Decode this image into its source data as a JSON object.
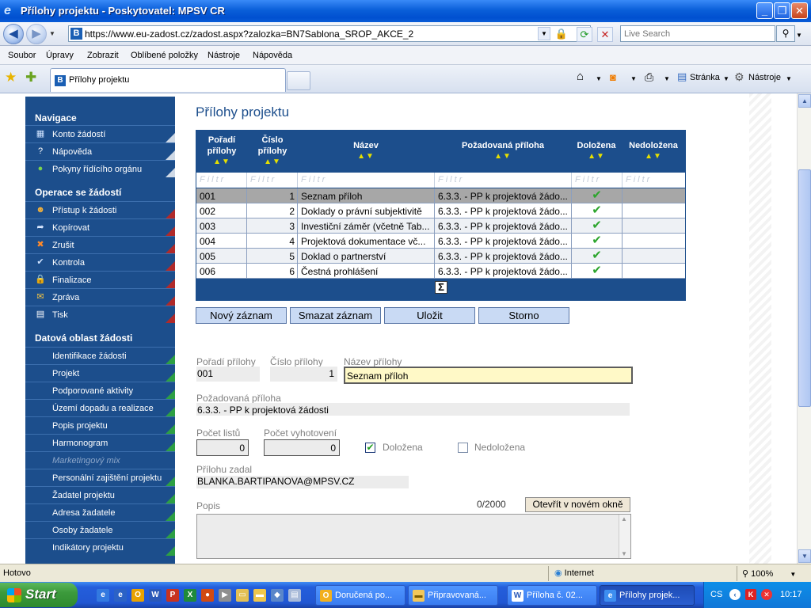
{
  "window": {
    "title": "Přílohy projektu - Poskytovatel: MPSV CR",
    "minimize_glyph": "_",
    "maximize_glyph": "❐",
    "close_glyph": "✕"
  },
  "address": {
    "url": "https://www.eu-zadost.cz/zadost.aspx?zalozka=BN7Sablona_SROP_AKCE_2",
    "search_placeholder": "Live Search",
    "favicon_letter": "B"
  },
  "menu": [
    "Soubor",
    "Úpravy",
    "Zobrazit",
    "Oblíbené položky",
    "Nástroje",
    "Nápověda"
  ],
  "tab": {
    "label": "Přílohy projektu"
  },
  "toolbar": {
    "page_label": "Stránka",
    "tools_label": "Nástroje"
  },
  "sidebar": {
    "sections": {
      "navigace": "Navigace",
      "operace": "Operace se žádostí",
      "datova": "Datová oblast žádosti"
    },
    "navigace": [
      {
        "label": "Konto žádostí",
        "icon": "account-icon"
      },
      {
        "label": "Nápověda",
        "icon": "help-icon"
      },
      {
        "label": "Pokyny řídícího orgánu",
        "icon": "instructions-icon"
      }
    ],
    "operace": [
      {
        "label": "Přístup k žádosti",
        "icon": "users-icon"
      },
      {
        "label": "Kopírovat",
        "icon": "copy-arrow-icon"
      },
      {
        "label": "Zrušit",
        "icon": "cancel-icon"
      },
      {
        "label": "Kontrola",
        "icon": "check-icon"
      },
      {
        "label": "Finalizace",
        "icon": "lock-icon"
      },
      {
        "label": "Zpráva",
        "icon": "envelope-icon"
      },
      {
        "label": "Tisk",
        "icon": "print-icon"
      }
    ],
    "datova": [
      "Identifikace žádosti",
      "Projekt",
      "Podporované aktivity",
      "Území dopadu a realizace",
      "Popis projektu",
      "Harmonogram",
      "Marketingový mix",
      "Personální zajištění projektu",
      "Žadatel projektu",
      "Adresa žadatele",
      "Osoby žadatele",
      "Indikátory projektu"
    ]
  },
  "main": {
    "heading": "Přílohy projektu",
    "columns": [
      "Pořadí přílohy",
      "Číslo přílohy",
      "Název",
      "Požadovaná příloha",
      "Doložena",
      "Nedoložena"
    ],
    "sort_glyph": "▲▼",
    "filter_text": "Filtr",
    "rows": [
      {
        "poradi": "001",
        "cislo": "1",
        "nazev": "Seznam příloh",
        "pozadovana": "6.3.3. - PP k projektová žádo...",
        "dolozena": "✔"
      },
      {
        "poradi": "002",
        "cislo": "2",
        "nazev": "Doklady o právní subjektivitě",
        "pozadovana": "6.3.3. - PP k projektová žádo...",
        "dolozena": "✔"
      },
      {
        "poradi": "003",
        "cislo": "3",
        "nazev": "Investiční záměr (včetně Tab...",
        "pozadovana": "6.3.3. - PP k projektová žádo...",
        "dolozena": "✔"
      },
      {
        "poradi": "004",
        "cislo": "4",
        "nazev": "Projektová dokumentace vč...",
        "pozadovana": "6.3.3. - PP k projektová žádo...",
        "dolozena": "✔"
      },
      {
        "poradi": "005",
        "cislo": "5",
        "nazev": "Doklad o partnerství",
        "pozadovana": "6.3.3. - PP k projektová žádo...",
        "dolozena": "✔"
      },
      {
        "poradi": "006",
        "cislo": "6",
        "nazev": "Čestná prohlášení",
        "pozadovana": "6.3.3. - PP k projektová žádo...",
        "dolozena": "✔"
      }
    ],
    "sigma": "Σ",
    "buttons": {
      "new": "Nový záznam",
      "delete": "Smazat záznam",
      "save": "Uložit",
      "cancel": "Storno"
    }
  },
  "form": {
    "poradi_label": "Pořadí přílohy",
    "poradi_value": "001",
    "cislo_label": "Číslo přílohy",
    "cislo_value": "1",
    "nazev_label": "Název přílohy",
    "nazev_value": "Seznam příloh",
    "pozadovana_label": "Požadovaná příloha",
    "pozadovana_value": "6.3.3. - PP k projektová žádosti",
    "pocet_listu_label": "Počet listů",
    "pocet_listu_value": "0",
    "pocet_vyhotoveni_label": "Počet vyhotovení",
    "pocet_vyhotoveni_value": "0",
    "dolozena_label": "Doložena",
    "dolozena_checked": true,
    "nedolozena_label": "Nedoložena",
    "nedolozena_checked": false,
    "zadal_label": "Přílohu zadal",
    "zadal_value": "BLANKA.BARTIPANOVA@MPSV.CZ",
    "popis_label": "Popis",
    "popis_counter": "0/2000",
    "open_button": "Otevřít v novém okně"
  },
  "status": {
    "text": "Hotovo",
    "zone": "Internet",
    "zoom": "100%"
  },
  "taskbar": {
    "start": "Start",
    "tasks": [
      {
        "label": "Doručená po...",
        "icon": "outlook-icon"
      },
      {
        "label": "Připravovaná...",
        "icon": "folder-icon"
      },
      {
        "label": "Příloha č. 02...",
        "icon": "word-icon"
      },
      {
        "label": "Přílohy projek...",
        "icon": "ie-icon"
      }
    ],
    "lang": "CS",
    "time": "10:17"
  },
  "colors": {
    "nav_bg": "#1c4e8c",
    "selected_row": "#a7a7a7",
    "check": "#2ca52c",
    "button": "#c9daf4",
    "input_highlight": "#fff9c7"
  }
}
